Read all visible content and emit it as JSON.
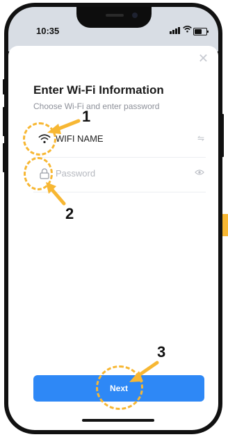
{
  "status_bar": {
    "time": "10:35"
  },
  "dialog": {
    "close_icon": "close-icon",
    "title": "Enter Wi-Fi Information",
    "subtitle": "Choose Wi-Fi and enter password",
    "wifi_row": {
      "icon": "wifi-icon",
      "value": "WIFI NAME",
      "action_icon": "switch-network-icon"
    },
    "password_row": {
      "icon": "lock-icon",
      "placeholder": "Password",
      "action_icon": "eye-icon"
    },
    "next_label": "Next"
  },
  "annotations": {
    "labels": [
      "1",
      "2",
      "3"
    ],
    "color": "#f7b733"
  },
  "colors": {
    "accent": "#2e88f6",
    "annotation": "#f7b733"
  }
}
